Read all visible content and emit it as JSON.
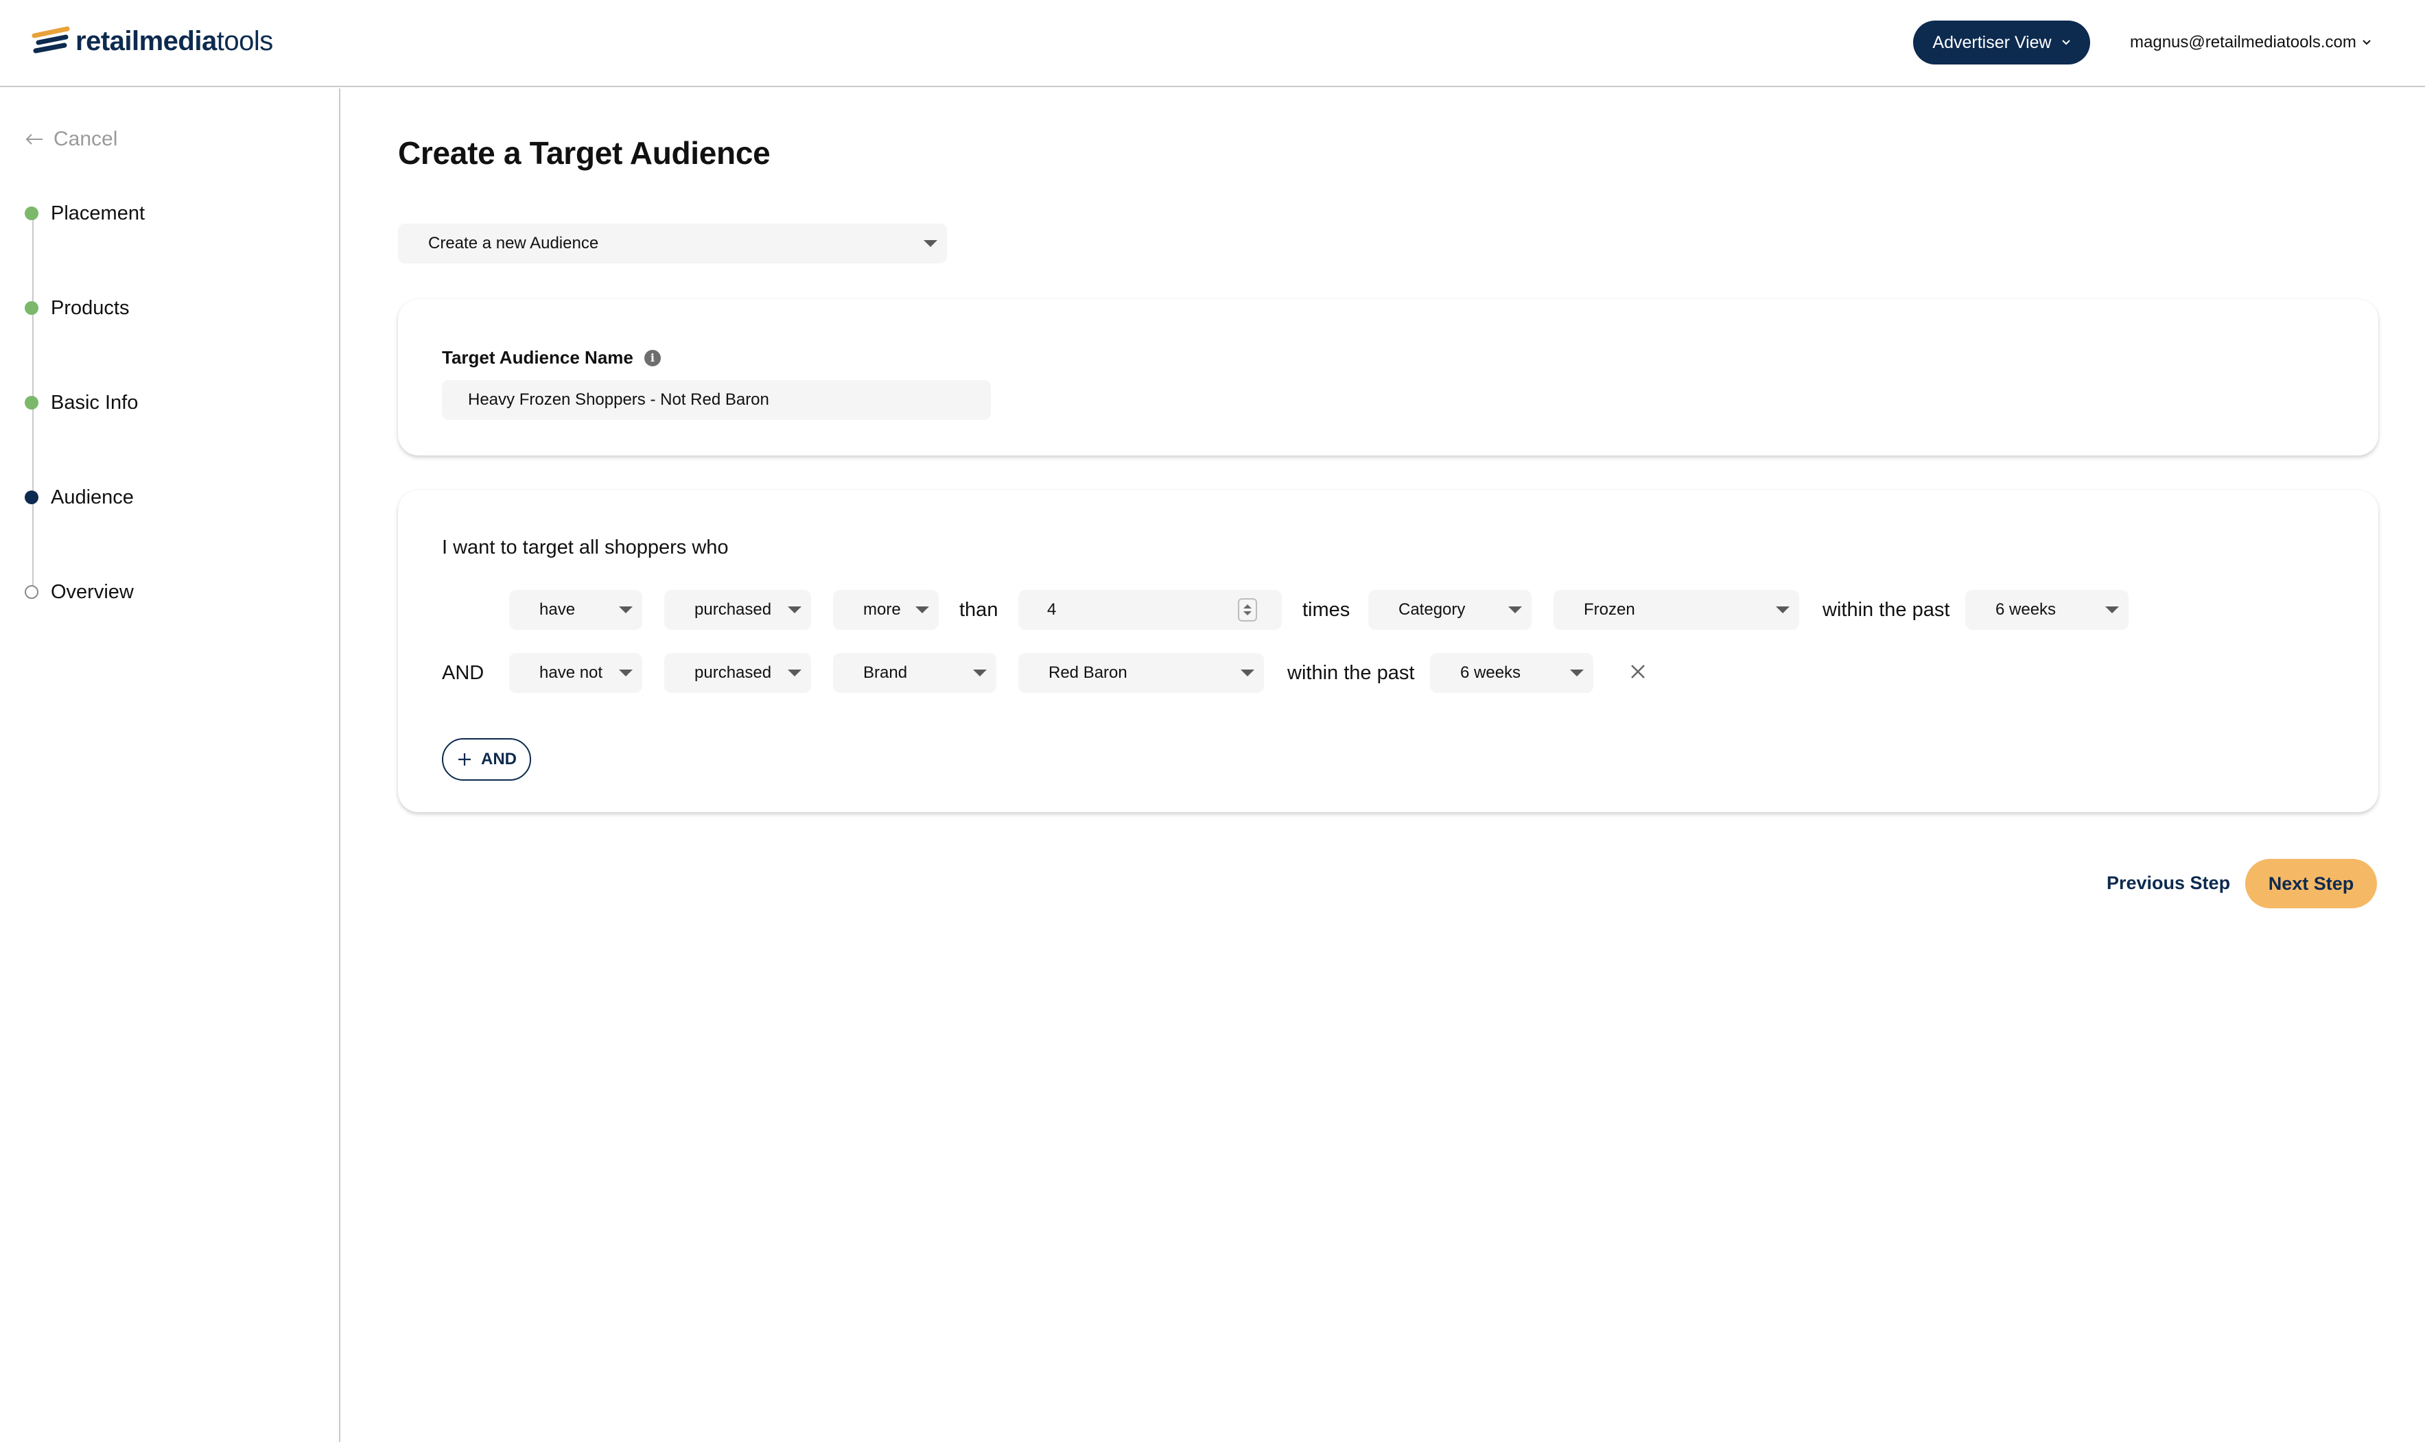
{
  "header": {
    "logo_bold": "retailmedia",
    "logo_thin": "tools",
    "view_button": "Advertiser View",
    "user_email": "magnus@retailmediatools.com"
  },
  "sidebar": {
    "cancel": "Cancel",
    "steps": [
      {
        "label": "Placement",
        "state": "done"
      },
      {
        "label": "Products",
        "state": "done"
      },
      {
        "label": "Basic Info",
        "state": "done"
      },
      {
        "label": "Audience",
        "state": "current"
      },
      {
        "label": "Overview",
        "state": "pending"
      }
    ]
  },
  "main": {
    "title": "Create a Target Audience",
    "audience_select": "Create a new Audience",
    "name_card": {
      "label": "Target Audience Name",
      "value": "Heavy Frozen Shoppers - Not Red Baron"
    },
    "rules": {
      "intro": "I want to target all shoppers who",
      "row1": {
        "verb": "have",
        "action": "purchased",
        "comparison": "more",
        "than": "than",
        "quantity": "4",
        "times": "times",
        "scope": "Category",
        "value": "Frozen",
        "within": "within the past",
        "period": "6 weeks"
      },
      "row2": {
        "connector": "AND",
        "verb": "have not",
        "action": "purchased",
        "scope": "Brand",
        "value": "Red Baron",
        "within": "within the past",
        "period": "6 weeks"
      },
      "add_button": "AND"
    },
    "previous_step": "Previous Step",
    "next_step": "Next Step"
  },
  "colors": {
    "navy": "#0d2a4f",
    "green_done": "#7cb86a",
    "accent_orange": "#f5b865",
    "field_bg": "#f5f5f5"
  }
}
